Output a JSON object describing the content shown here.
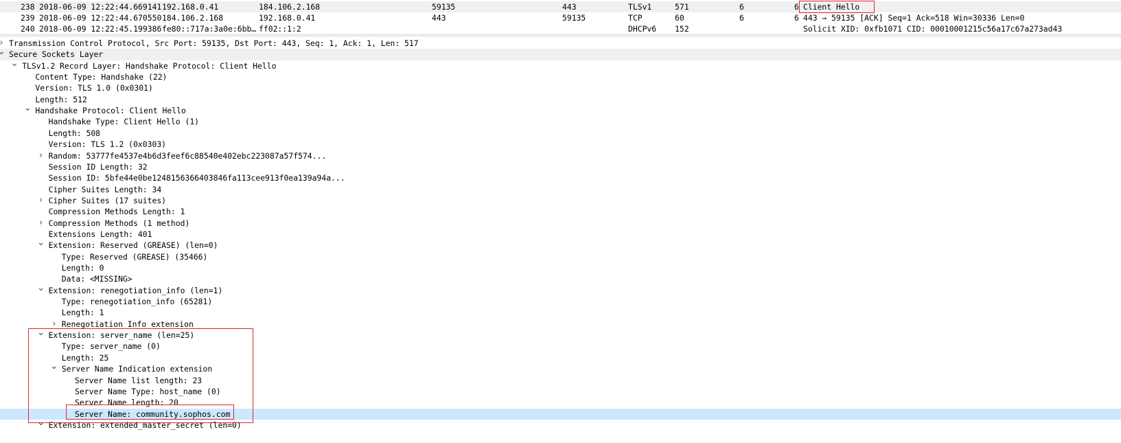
{
  "packet_list": {
    "rows": [
      {
        "no": "238",
        "time": "2018-06-09 12:22:44.669141",
        "src": "192.168.0.41",
        "dst": "184.106.2.168",
        "sport": "59135",
        "dport": "443",
        "proto": "TLSv1",
        "len": "571",
        "c1": "6",
        "c2": "6",
        "info": "Client Hello"
      },
      {
        "no": "239",
        "time": "2018-06-09 12:22:44.670550",
        "src": "184.106.2.168",
        "dst": "192.168.0.41",
        "sport": "443",
        "dport": "59135",
        "proto": "TCP",
        "len": "60",
        "c1": "6",
        "c2": "6",
        "info": "443 → 59135 [ACK] Seq=1 Ack=518 Win=30336 Len=0"
      },
      {
        "no": "240",
        "time": "2018-06-09 12:22:45.199386",
        "src": "fe80::717a:3a0e:6bb…",
        "dst": "ff02::1:2",
        "sport": "",
        "dport": "",
        "proto": "DHCPv6",
        "len": "152",
        "c1": "",
        "c2": "",
        "info": "Solicit XID: 0xfb1071 CID: 00010001215c56a17c67a273ad43"
      }
    ]
  },
  "details": {
    "rows": [
      {
        "text": "Transmission Control Protocol, Src Port: 59135, Dst Port: 443, Seq: 1, Ack: 1, Len: 517",
        "level": 0,
        "arrow": "right"
      },
      {
        "text": "Secure Sockets Layer",
        "level": 0,
        "arrow": "down"
      },
      {
        "text": "TLSv1.2 Record Layer: Handshake Protocol: Client Hello",
        "level": 1,
        "arrow": "down"
      },
      {
        "text": "Content Type: Handshake (22)",
        "level": 2,
        "arrow": ""
      },
      {
        "text": "Version: TLS 1.0 (0x0301)",
        "level": 2,
        "arrow": ""
      },
      {
        "text": "Length: 512",
        "level": 2,
        "arrow": ""
      },
      {
        "text": "Handshake Protocol: Client Hello",
        "level": 2,
        "arrow": "down"
      },
      {
        "text": "Handshake Type: Client Hello (1)",
        "level": 3,
        "arrow": ""
      },
      {
        "text": "Length: 508",
        "level": 3,
        "arrow": ""
      },
      {
        "text": "Version: TLS 1.2 (0x0303)",
        "level": 3,
        "arrow": ""
      },
      {
        "text": "Random: 53777fe4537e4b6d3feef6c88540e402ebc223087a57f574...",
        "level": 3,
        "arrow": "right"
      },
      {
        "text": "Session ID Length: 32",
        "level": 3,
        "arrow": ""
      },
      {
        "text": "Session ID: 5bfe44e0be1248156366403846fa113cee913f0ea139a94a...",
        "level": 3,
        "arrow": ""
      },
      {
        "text": "Cipher Suites Length: 34",
        "level": 3,
        "arrow": ""
      },
      {
        "text": "Cipher Suites (17 suites)",
        "level": 3,
        "arrow": "right"
      },
      {
        "text": "Compression Methods Length: 1",
        "level": 3,
        "arrow": ""
      },
      {
        "text": "Compression Methods (1 method)",
        "level": 3,
        "arrow": "right"
      },
      {
        "text": "Extensions Length: 401",
        "level": 3,
        "arrow": ""
      },
      {
        "text": "Extension: Reserved (GREASE) (len=0)",
        "level": 3,
        "arrow": "down"
      },
      {
        "text": "Type: Reserved (GREASE) (35466)",
        "level": 4,
        "arrow": ""
      },
      {
        "text": "Length: 0",
        "level": 4,
        "arrow": ""
      },
      {
        "text": "Data: <MISSING>",
        "level": 4,
        "arrow": ""
      },
      {
        "text": "Extension: renegotiation_info (len=1)",
        "level": 3,
        "arrow": "down"
      },
      {
        "text": "Type: renegotiation_info (65281)",
        "level": 4,
        "arrow": ""
      },
      {
        "text": "Length: 1",
        "level": 4,
        "arrow": ""
      },
      {
        "text": "Renegotiation Info extension",
        "level": 4,
        "arrow": "right"
      },
      {
        "text": "Extension: server_name (len=25)",
        "level": 3,
        "arrow": "down"
      },
      {
        "text": "Type: server_name (0)",
        "level": 4,
        "arrow": ""
      },
      {
        "text": "Length: 25",
        "level": 4,
        "arrow": ""
      },
      {
        "text": "Server Name Indication extension",
        "level": 4,
        "arrow": "down"
      },
      {
        "text": "Server Name list length: 23",
        "level": 5,
        "arrow": ""
      },
      {
        "text": "Server Name Type: host_name (0)",
        "level": 5,
        "arrow": ""
      },
      {
        "text": "Server Name length: 20",
        "level": 5,
        "arrow": ""
      },
      {
        "text": "Server Name: community.sophos.com",
        "level": 5,
        "arrow": ""
      },
      {
        "text": "Extension: extended_master_secret (len=0)",
        "level": 3,
        "arrow": "down"
      }
    ],
    "selected_index": 33,
    "band_indices": [
      1
    ]
  },
  "icons": {
    "expanded": "chevron-down-icon",
    "collapsed": "chevron-right-icon"
  },
  "colors": {
    "highlight_row": "#cce8ff",
    "annotation_box": "#d9262c",
    "band_row": "#f0f0f0"
  }
}
